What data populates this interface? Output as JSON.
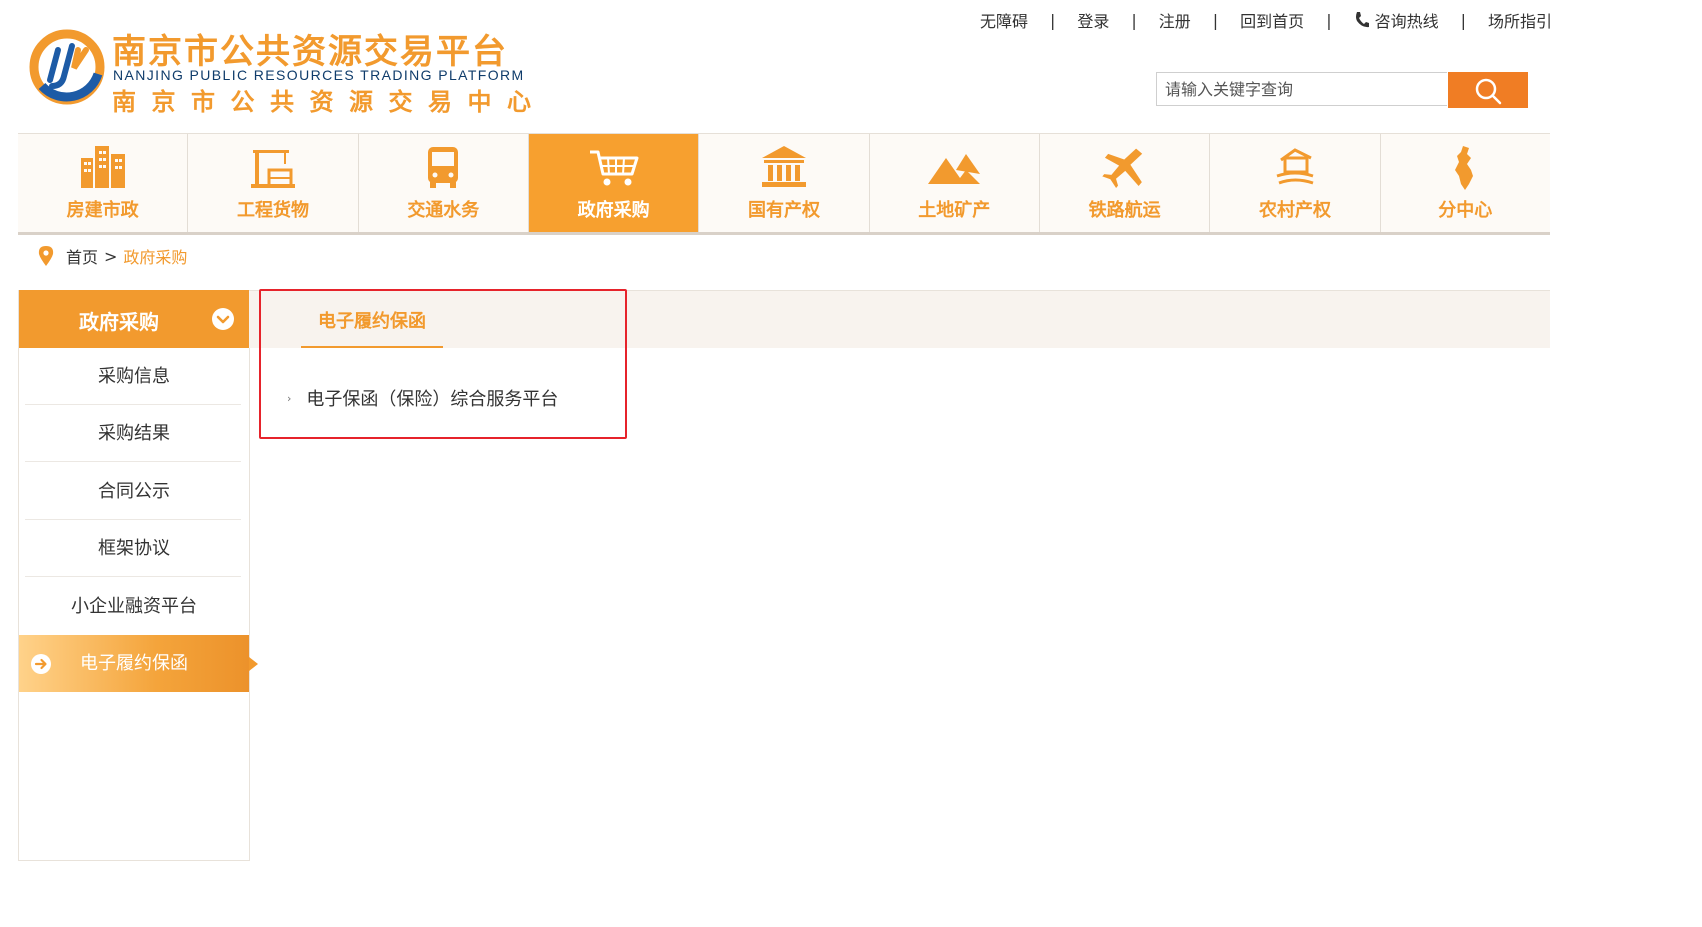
{
  "logo": {
    "cn": "南京市公共资源交易平台",
    "en": "NANJING PUBLIC RESOURCES TRADING PLATFORM",
    "sub": "南京市公共资源交易中心"
  },
  "toplinks": {
    "accessibility": "无障碍",
    "login": "登录",
    "register": "注册",
    "home": "回到首页",
    "hotline": "咨询热线",
    "guide": "场所指引",
    "separator": "|"
  },
  "search": {
    "placeholder": "请输入关键字查询"
  },
  "nav": {
    "items": [
      {
        "label": "房建市政",
        "icon": "buildings-icon"
      },
      {
        "label": "工程货物",
        "icon": "crane-icon"
      },
      {
        "label": "交通水务",
        "icon": "bus-icon"
      },
      {
        "label": "政府采购",
        "icon": "cart-icon"
      },
      {
        "label": "国有产权",
        "icon": "bank-icon"
      },
      {
        "label": "土地矿产",
        "icon": "mountain-icon"
      },
      {
        "label": "铁路航运",
        "icon": "plane-icon"
      },
      {
        "label": "农村产权",
        "icon": "farm-icon"
      },
      {
        "label": "分中心",
        "icon": "map-icon"
      }
    ],
    "active_index": 3
  },
  "breadcrumb": {
    "home": "首页",
    "separator": ">",
    "current": "政府采购"
  },
  "sidebar": {
    "title": "政府采购",
    "items": [
      {
        "label": "采购信息"
      },
      {
        "label": "采购结果"
      },
      {
        "label": "合同公示"
      },
      {
        "label": "框架协议"
      },
      {
        "label": "小企业融资平台"
      },
      {
        "label": "电子履约保函"
      }
    ],
    "active_index": 5
  },
  "content": {
    "tab": "电子履约保函",
    "entries": [
      {
        "label": "电子保函（保险）综合服务平台"
      }
    ],
    "bullet": "›"
  },
  "colors": {
    "brand_orange": "#f29a2e",
    "search_button": "#f07d24",
    "highlight_border": "#e6232b"
  }
}
